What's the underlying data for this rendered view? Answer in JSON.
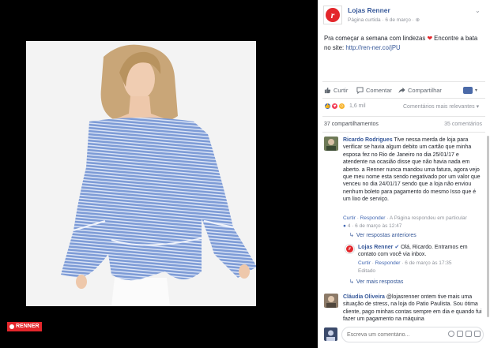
{
  "brand": {
    "badge": "RENNER",
    "logo_letter": "r",
    "accent": "#e3262b",
    "link_color": "#365899"
  },
  "post": {
    "page_name": "Lojas Renner",
    "meta": "Página curtida · 6 de março · ",
    "text_before": "Pra começar a semana com lindezas ",
    "text_after": " Encontre a bata no site: ",
    "url": "http://ren-ner.co/jPU"
  },
  "actions": {
    "like": "Curtir",
    "comment": "Comentar",
    "share": "Compartilhar"
  },
  "reactions": {
    "count": "1,6 mil",
    "relevance": "Comentários mais relevantes"
  },
  "counts": {
    "shares": "37 compartilhamentos",
    "comments": "35 comentários"
  },
  "comments": [
    {
      "name": "Ricardo Rodrigues",
      "text": "Tive nessa merda de loja para verificar se havia algum debito um cartão que minha esposa fez no Rio de Janeiro no dia 25/01/17 e atendente na ocasião disse que não havia nada em aberto. a Renner nunca mandou uma fatura, agora vejo que meu nome esta sendo negativado por um valor que venceu no dia 24/01/17 sendo que a loja não enviou nenhum boleto para pagamento do mesmo Isso que é um lixo de serviço.",
      "like": "Curtir",
      "reply": "Responder",
      "page_replied": "A Página respondeu em particular",
      "reaction_count": "4",
      "date": "6 de março às 12:47"
    },
    {
      "name": "Cláudia Oliveira",
      "text": "@lojasrenner ontem tive mais uma situação de stress, na loja do Patio Paulista. Sou ótima cliente, pago minhas contas sempre em dia e quando fui fazer um pagamento na máquina"
    }
  ],
  "replies": {
    "previous": "Ver respostas anteriores",
    "name": "Lojas Renner",
    "text": "Olá, Ricardo. Entramos em contato com você via inbox.",
    "like": "Curtir",
    "reply": "Responder",
    "date": "6 de março às 17:35",
    "edited": "Editado",
    "more": "Ver mais respostas"
  },
  "composer": {
    "placeholder": "Escreva um comentário..."
  }
}
